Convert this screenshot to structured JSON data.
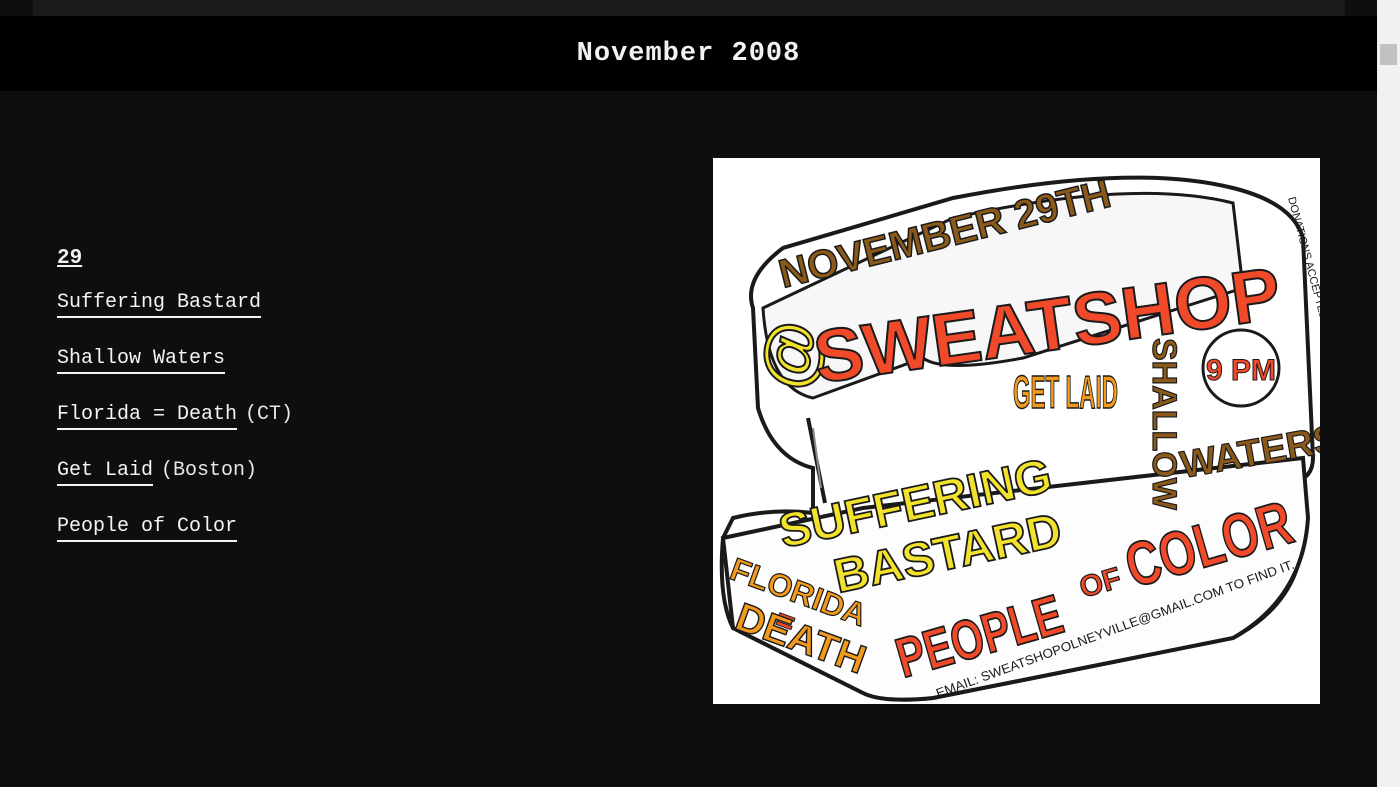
{
  "header": {
    "title": "November 2008"
  },
  "event": {
    "day": "29",
    "bands": [
      {
        "name": "Suffering Bastard",
        "note": ""
      },
      {
        "name": "Shallow Waters",
        "note": ""
      },
      {
        "name": "Florida = Death",
        "note": "(CT)"
      },
      {
        "name": "Get Laid",
        "note": "(Boston)"
      },
      {
        "name": "People of Color",
        "note": ""
      }
    ]
  },
  "flyer": {
    "date": "NOVEMBER 29TH",
    "venue_prefix": "@",
    "venue": "SWEATSHOP",
    "time": "9 PM",
    "donations": "DONATIONS ACCEPTED!",
    "bands": [
      "GET LAID",
      "SHALLOW",
      "WATERS",
      "SUFFERING",
      "BASTARD",
      "FLORIDA",
      "=",
      "DEATH",
      "PEOPLE",
      "OF",
      "COLOR"
    ],
    "email": "EMAIL: SWEATSHOPOLNEYVILLE@GMAIL.COM TO FIND IT."
  },
  "colors": {
    "background": "#0e0e0e",
    "header_bg": "#000000",
    "text": "#f2f2f2",
    "flyer_red": "#f04a2a",
    "flyer_orange": "#f39a1c",
    "flyer_yellow": "#f2e22c",
    "flyer_brown": "#8b5a1a"
  }
}
